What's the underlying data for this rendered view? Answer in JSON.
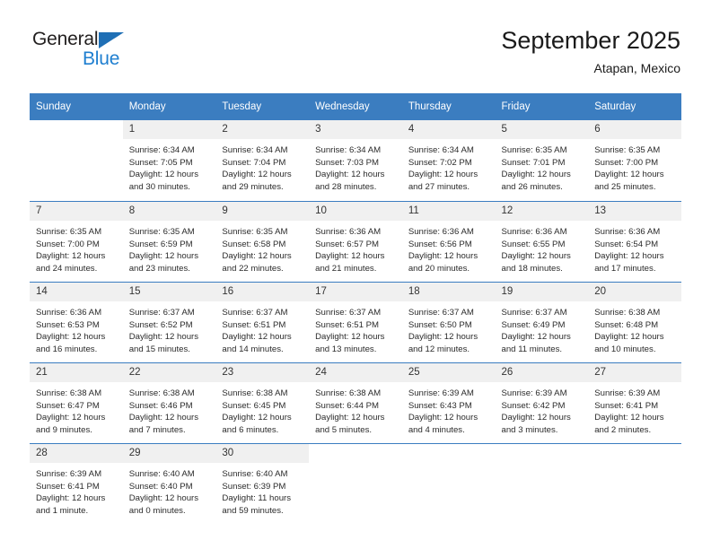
{
  "brand": {
    "name_part1": "General",
    "name_part2": "Blue",
    "accent_color": "#1f7fd0",
    "triangle_color": "#1f6fb5"
  },
  "header": {
    "title": "September 2025",
    "location": "Atapan, Mexico"
  },
  "theme": {
    "header_blue": "#3b7dc0",
    "daynum_band": "#f0f0f0",
    "text": "#2b2b2b"
  },
  "weekdays": [
    "Sunday",
    "Monday",
    "Tuesday",
    "Wednesday",
    "Thursday",
    "Friday",
    "Saturday"
  ],
  "labels": {
    "sunrise": "Sunrise:",
    "sunset": "Sunset:",
    "daylight": "Daylight:"
  },
  "weeks": [
    [
      {
        "day": "",
        "sunrise": "",
        "sunset": "",
        "daylight_line1": "",
        "daylight_line2": ""
      },
      {
        "day": "1",
        "sunrise": "Sunrise: 6:34 AM",
        "sunset": "Sunset: 7:05 PM",
        "daylight_line1": "Daylight: 12 hours",
        "daylight_line2": "and 30 minutes."
      },
      {
        "day": "2",
        "sunrise": "Sunrise: 6:34 AM",
        "sunset": "Sunset: 7:04 PM",
        "daylight_line1": "Daylight: 12 hours",
        "daylight_line2": "and 29 minutes."
      },
      {
        "day": "3",
        "sunrise": "Sunrise: 6:34 AM",
        "sunset": "Sunset: 7:03 PM",
        "daylight_line1": "Daylight: 12 hours",
        "daylight_line2": "and 28 minutes."
      },
      {
        "day": "4",
        "sunrise": "Sunrise: 6:34 AM",
        "sunset": "Sunset: 7:02 PM",
        "daylight_line1": "Daylight: 12 hours",
        "daylight_line2": "and 27 minutes."
      },
      {
        "day": "5",
        "sunrise": "Sunrise: 6:35 AM",
        "sunset": "Sunset: 7:01 PM",
        "daylight_line1": "Daylight: 12 hours",
        "daylight_line2": "and 26 minutes."
      },
      {
        "day": "6",
        "sunrise": "Sunrise: 6:35 AM",
        "sunset": "Sunset: 7:00 PM",
        "daylight_line1": "Daylight: 12 hours",
        "daylight_line2": "and 25 minutes."
      }
    ],
    [
      {
        "day": "7",
        "sunrise": "Sunrise: 6:35 AM",
        "sunset": "Sunset: 7:00 PM",
        "daylight_line1": "Daylight: 12 hours",
        "daylight_line2": "and 24 minutes."
      },
      {
        "day": "8",
        "sunrise": "Sunrise: 6:35 AM",
        "sunset": "Sunset: 6:59 PM",
        "daylight_line1": "Daylight: 12 hours",
        "daylight_line2": "and 23 minutes."
      },
      {
        "day": "9",
        "sunrise": "Sunrise: 6:35 AM",
        "sunset": "Sunset: 6:58 PM",
        "daylight_line1": "Daylight: 12 hours",
        "daylight_line2": "and 22 minutes."
      },
      {
        "day": "10",
        "sunrise": "Sunrise: 6:36 AM",
        "sunset": "Sunset: 6:57 PM",
        "daylight_line1": "Daylight: 12 hours",
        "daylight_line2": "and 21 minutes."
      },
      {
        "day": "11",
        "sunrise": "Sunrise: 6:36 AM",
        "sunset": "Sunset: 6:56 PM",
        "daylight_line1": "Daylight: 12 hours",
        "daylight_line2": "and 20 minutes."
      },
      {
        "day": "12",
        "sunrise": "Sunrise: 6:36 AM",
        "sunset": "Sunset: 6:55 PM",
        "daylight_line1": "Daylight: 12 hours",
        "daylight_line2": "and 18 minutes."
      },
      {
        "day": "13",
        "sunrise": "Sunrise: 6:36 AM",
        "sunset": "Sunset: 6:54 PM",
        "daylight_line1": "Daylight: 12 hours",
        "daylight_line2": "and 17 minutes."
      }
    ],
    [
      {
        "day": "14",
        "sunrise": "Sunrise: 6:36 AM",
        "sunset": "Sunset: 6:53 PM",
        "daylight_line1": "Daylight: 12 hours",
        "daylight_line2": "and 16 minutes."
      },
      {
        "day": "15",
        "sunrise": "Sunrise: 6:37 AM",
        "sunset": "Sunset: 6:52 PM",
        "daylight_line1": "Daylight: 12 hours",
        "daylight_line2": "and 15 minutes."
      },
      {
        "day": "16",
        "sunrise": "Sunrise: 6:37 AM",
        "sunset": "Sunset: 6:51 PM",
        "daylight_line1": "Daylight: 12 hours",
        "daylight_line2": "and 14 minutes."
      },
      {
        "day": "17",
        "sunrise": "Sunrise: 6:37 AM",
        "sunset": "Sunset: 6:51 PM",
        "daylight_line1": "Daylight: 12 hours",
        "daylight_line2": "and 13 minutes."
      },
      {
        "day": "18",
        "sunrise": "Sunrise: 6:37 AM",
        "sunset": "Sunset: 6:50 PM",
        "daylight_line1": "Daylight: 12 hours",
        "daylight_line2": "and 12 minutes."
      },
      {
        "day": "19",
        "sunrise": "Sunrise: 6:37 AM",
        "sunset": "Sunset: 6:49 PM",
        "daylight_line1": "Daylight: 12 hours",
        "daylight_line2": "and 11 minutes."
      },
      {
        "day": "20",
        "sunrise": "Sunrise: 6:38 AM",
        "sunset": "Sunset: 6:48 PM",
        "daylight_line1": "Daylight: 12 hours",
        "daylight_line2": "and 10 minutes."
      }
    ],
    [
      {
        "day": "21",
        "sunrise": "Sunrise: 6:38 AM",
        "sunset": "Sunset: 6:47 PM",
        "daylight_line1": "Daylight: 12 hours",
        "daylight_line2": "and 9 minutes."
      },
      {
        "day": "22",
        "sunrise": "Sunrise: 6:38 AM",
        "sunset": "Sunset: 6:46 PM",
        "daylight_line1": "Daylight: 12 hours",
        "daylight_line2": "and 7 minutes."
      },
      {
        "day": "23",
        "sunrise": "Sunrise: 6:38 AM",
        "sunset": "Sunset: 6:45 PM",
        "daylight_line1": "Daylight: 12 hours",
        "daylight_line2": "and 6 minutes."
      },
      {
        "day": "24",
        "sunrise": "Sunrise: 6:38 AM",
        "sunset": "Sunset: 6:44 PM",
        "daylight_line1": "Daylight: 12 hours",
        "daylight_line2": "and 5 minutes."
      },
      {
        "day": "25",
        "sunrise": "Sunrise: 6:39 AM",
        "sunset": "Sunset: 6:43 PM",
        "daylight_line1": "Daylight: 12 hours",
        "daylight_line2": "and 4 minutes."
      },
      {
        "day": "26",
        "sunrise": "Sunrise: 6:39 AM",
        "sunset": "Sunset: 6:42 PM",
        "daylight_line1": "Daylight: 12 hours",
        "daylight_line2": "and 3 minutes."
      },
      {
        "day": "27",
        "sunrise": "Sunrise: 6:39 AM",
        "sunset": "Sunset: 6:41 PM",
        "daylight_line1": "Daylight: 12 hours",
        "daylight_line2": "and 2 minutes."
      }
    ],
    [
      {
        "day": "28",
        "sunrise": "Sunrise: 6:39 AM",
        "sunset": "Sunset: 6:41 PM",
        "daylight_line1": "Daylight: 12 hours",
        "daylight_line2": "and 1 minute."
      },
      {
        "day": "29",
        "sunrise": "Sunrise: 6:40 AM",
        "sunset": "Sunset: 6:40 PM",
        "daylight_line1": "Daylight: 12 hours",
        "daylight_line2": "and 0 minutes."
      },
      {
        "day": "30",
        "sunrise": "Sunrise: 6:40 AM",
        "sunset": "Sunset: 6:39 PM",
        "daylight_line1": "Daylight: 11 hours",
        "daylight_line2": "and 59 minutes."
      },
      {
        "day": "",
        "sunrise": "",
        "sunset": "",
        "daylight_line1": "",
        "daylight_line2": ""
      },
      {
        "day": "",
        "sunrise": "",
        "sunset": "",
        "daylight_line1": "",
        "daylight_line2": ""
      },
      {
        "day": "",
        "sunrise": "",
        "sunset": "",
        "daylight_line1": "",
        "daylight_line2": ""
      },
      {
        "day": "",
        "sunrise": "",
        "sunset": "",
        "daylight_line1": "",
        "daylight_line2": ""
      }
    ]
  ]
}
